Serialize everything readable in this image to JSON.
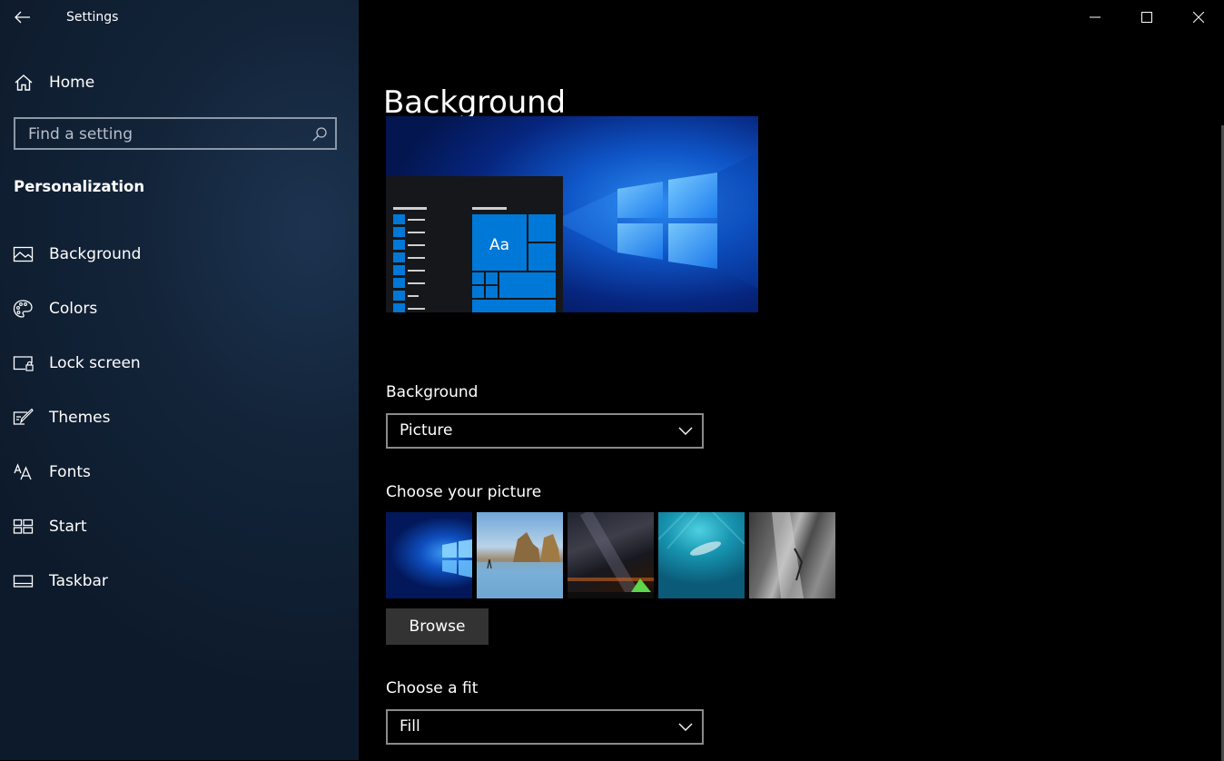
{
  "window": {
    "title": "Settings"
  },
  "sidebar": {
    "home_label": "Home",
    "search_placeholder": "Find a setting",
    "section_title": "Personalization",
    "items": [
      {
        "label": "Background",
        "icon": "picture-icon"
      },
      {
        "label": "Colors",
        "icon": "palette-icon"
      },
      {
        "label": "Lock screen",
        "icon": "lock-screen-icon"
      },
      {
        "label": "Themes",
        "icon": "themes-icon"
      },
      {
        "label": "Fonts",
        "icon": "fonts-icon"
      },
      {
        "label": "Start",
        "icon": "start-icon"
      },
      {
        "label": "Taskbar",
        "icon": "taskbar-icon"
      }
    ]
  },
  "main": {
    "page_title": "Background",
    "preview": {
      "sample_text": "Aa"
    },
    "background_field": {
      "label": "Background",
      "value": "Picture"
    },
    "picture_field": {
      "label": "Choose your picture",
      "thumbnails": [
        "windows-logo-wallpaper",
        "beach-rocks-wallpaper",
        "night-sky-tent-wallpaper",
        "underwater-swimmer-wallpaper",
        "rock-cliff-wallpaper"
      ]
    },
    "browse_label": "Browse",
    "fit_field": {
      "label": "Choose a fit",
      "value": "Fill"
    }
  },
  "colors": {
    "sidebar_bg": "#132439",
    "accent": "#0078d7",
    "button_bg": "#333333"
  }
}
